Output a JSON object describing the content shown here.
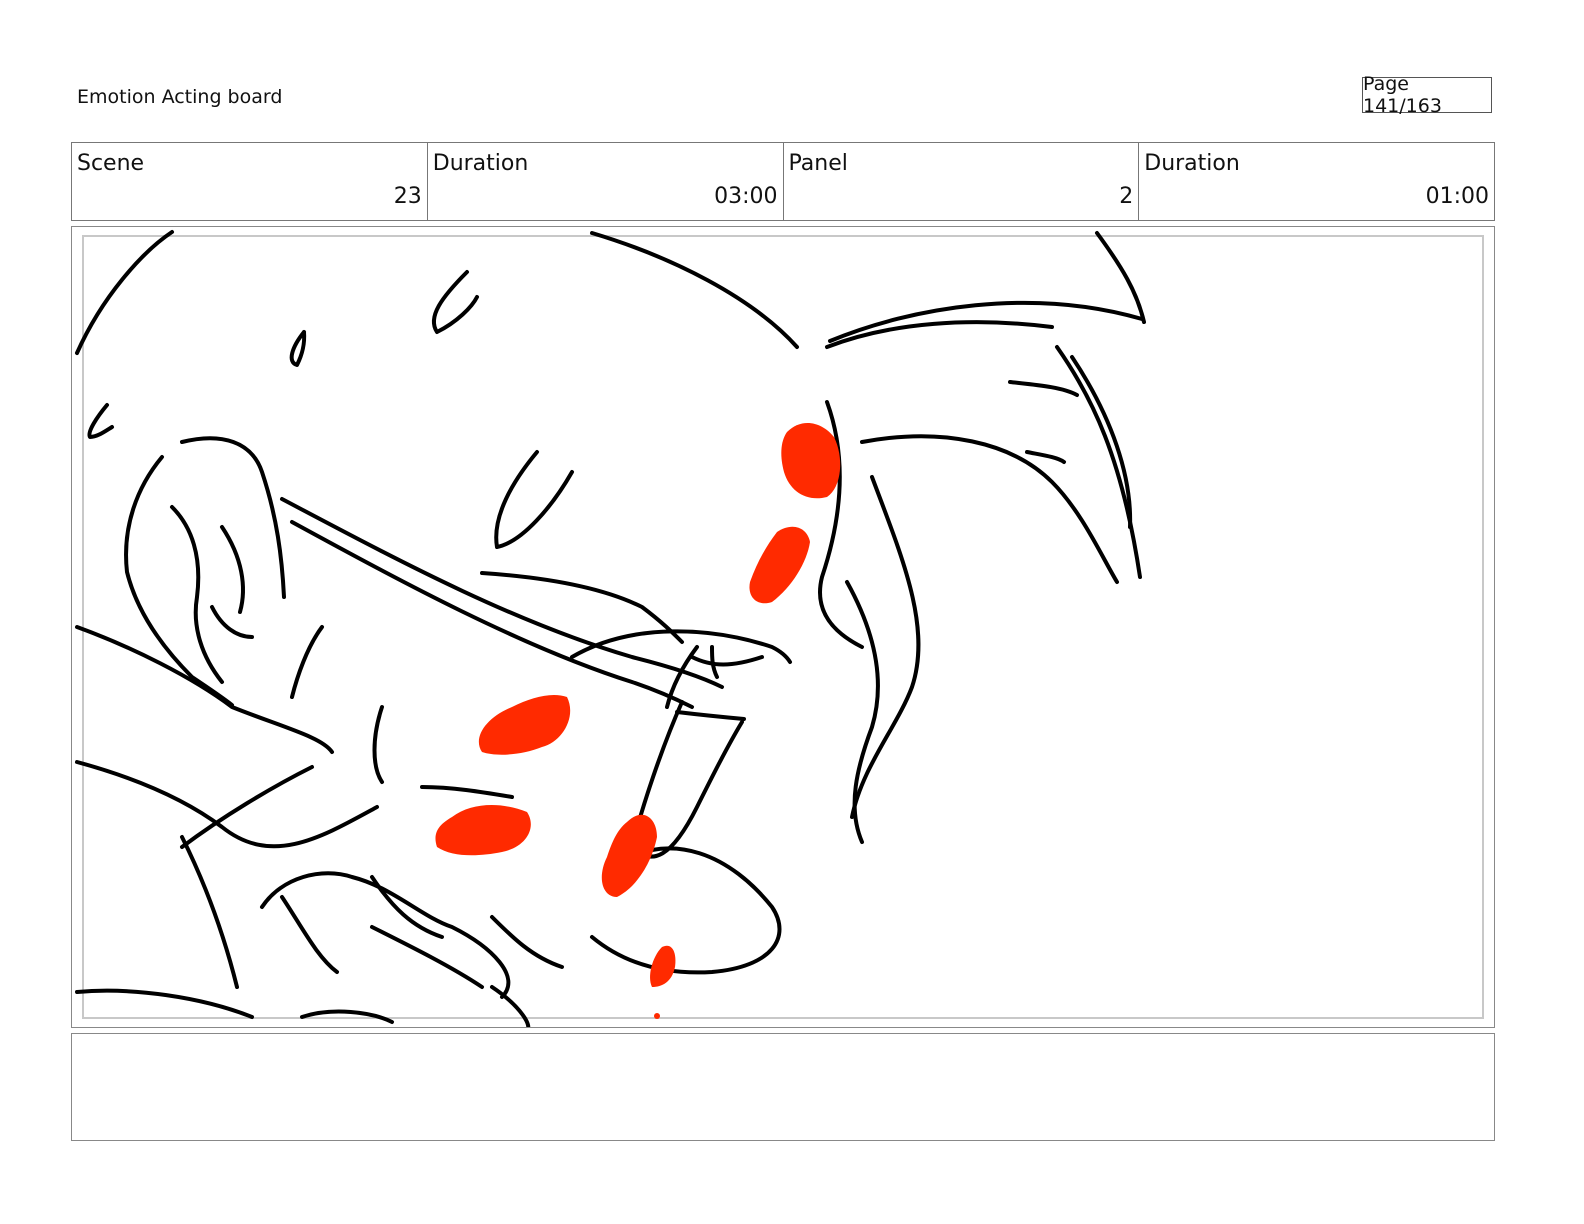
{
  "header": {
    "title": "Emotion Acting board",
    "page": "Page 141/163"
  },
  "info": [
    {
      "label": "Scene",
      "value": "23"
    },
    {
      "label": "Duration",
      "value": "03:00"
    },
    {
      "label": "Panel",
      "value": "2"
    },
    {
      "label": "Duration",
      "value": "01:00"
    }
  ],
  "panel": {
    "sketch": "sketch-drawing",
    "line_color": "#000000",
    "accent_color": "#ff2a00"
  },
  "notes": {
    "text": ""
  }
}
